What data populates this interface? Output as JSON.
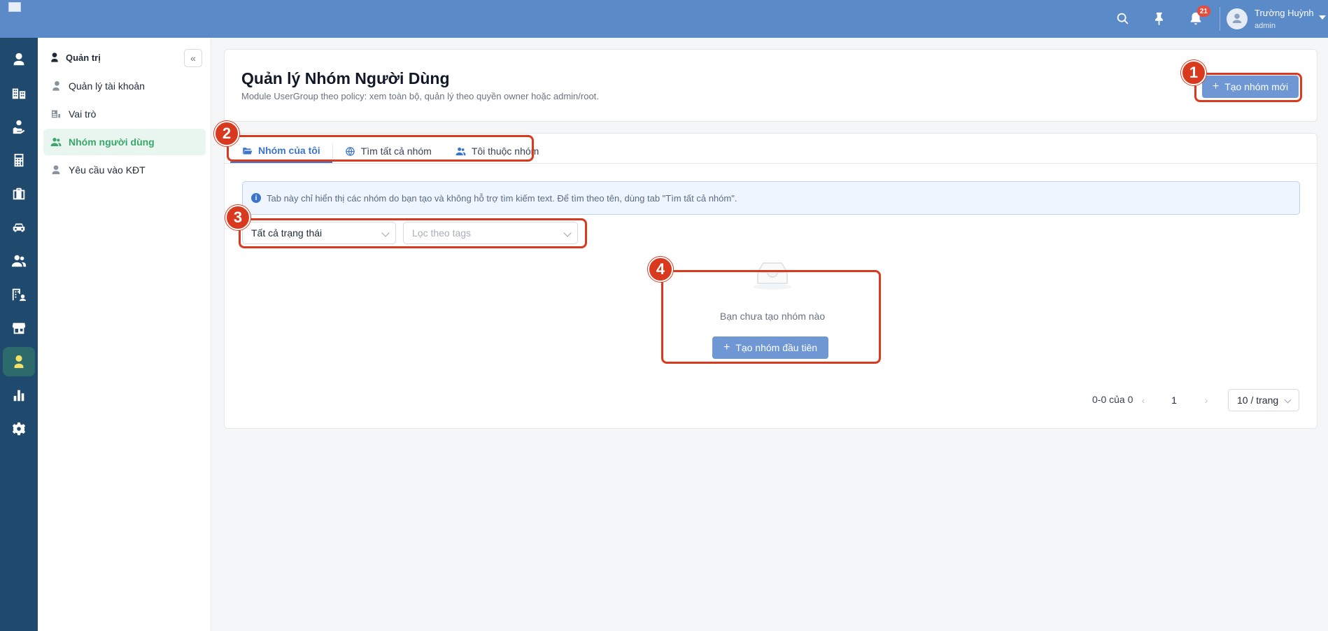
{
  "user": {
    "name": "Trường Huỳnh",
    "role": "admin",
    "notification_count": "21"
  },
  "topbar_icons": [
    "search-icon",
    "pin-icon",
    "bell-icon"
  ],
  "rail": [
    "user-icon",
    "buildings-icon",
    "user-hand-icon",
    "calculator-icon",
    "briefcase-icon",
    "car-icon",
    "users-icon",
    "building-user-icon",
    "store-icon",
    "user-admin-icon",
    "bar-chart-icon",
    "gear-icon"
  ],
  "sidebar": {
    "heading": "Quản trị",
    "items": [
      {
        "label": "Quản lý tài khoản",
        "icon": "user-tie-icon"
      },
      {
        "label": "Vai trò",
        "icon": "id-card-icon"
      },
      {
        "label": "Nhóm người dùng",
        "icon": "users-icon"
      },
      {
        "label": "Yêu cầu vào KĐT",
        "icon": "user-icon"
      }
    ]
  },
  "header": {
    "title": "Quản lý Nhóm Người Dùng",
    "subtitle": "Module UserGroup theo policy: xem toàn bộ, quản lý theo quyền owner hoặc admin/root.",
    "create_label": "Tạo nhóm mới"
  },
  "tabs": [
    {
      "label": "Nhóm của tôi",
      "icon": "folder-open-icon"
    },
    {
      "label": "Tìm tất cả nhóm",
      "icon": "globe-icon"
    },
    {
      "label": "Tôi thuộc nhóm",
      "icon": "users-icon"
    }
  ],
  "info": "Tab này chỉ hiển thị các nhóm do bạn tạo và không hỗ trợ tìm kiếm text. Để tìm theo tên, dùng tab \"Tìm tất cả nhóm\".",
  "filters": {
    "status_value": "Tất cả trạng thái",
    "tags_placeholder": "Lọc theo tags"
  },
  "empty": {
    "text": "Bạn chưa tạo nhóm nào",
    "button": "Tạo nhóm đầu tiên"
  },
  "pagination": {
    "total": "0-0 của 0",
    "page": "1",
    "page_size": "10 / trang"
  },
  "callouts": [
    "1",
    "2",
    "3",
    "4"
  ],
  "colors": {
    "topbar": "#5b8ac9",
    "rail": "#1f4a6e",
    "primary_button": "#6e97d3",
    "callout": "#d93a1f",
    "active_sidebar": "#3aa66b"
  }
}
